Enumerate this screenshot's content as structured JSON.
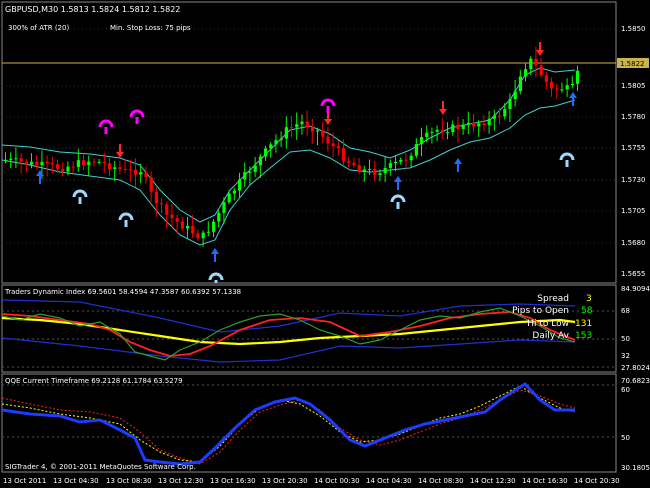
{
  "main": {
    "title": "GBPUSD,M30  1.5813 1.5824 1.5812 1.5822",
    "info_atr": "300% of ATR (20)",
    "info_stop": "Min. Stop Loss:  75 pips",
    "price_label": "1.5822",
    "y_ticks": [
      "1.5850",
      "1.5805",
      "1.5780",
      "1.5755",
      "1.5730",
      "1.5705",
      "1.5680",
      "1.5655"
    ],
    "colors": {
      "bull": "#00ff00",
      "bear": "#ff0000",
      "band": "#40d0d0",
      "price_line": "#c8b44c",
      "arrow_up": "#1e6cff",
      "arrow_down": "#ff2828",
      "fractal_top": "#ff00ff",
      "fractal_bot": "#9fd8ff"
    }
  },
  "tdi": {
    "title": "Traders Dynamic Index 69.5601 58.4594 47.3587 60.6392 57.1338",
    "y_ticks": [
      "84.9094",
      "68",
      "50",
      "32",
      "27.8024"
    ],
    "stats": [
      {
        "label": "Spread",
        "value": "3",
        "color": "#ffff00"
      },
      {
        "label": "Pips to Open",
        "value": "58",
        "color": "#00ff00"
      },
      {
        "label": "Hi to Low",
        "value": "131",
        "color": "#ffff00"
      },
      {
        "label": "Daily Av",
        "value": "153",
        "color": "#00ff00"
      }
    ],
    "colors": {
      "green": "#2e9e2e",
      "red": "#ff2222",
      "yellow": "#ffff00",
      "blue": "#2030d0"
    }
  },
  "qqe": {
    "title": "QQE Current Timeframe 69.2128 61.1784 63.5279",
    "y_ticks": [
      "70.6823",
      "60",
      "50",
      "30.1805"
    ],
    "colors": {
      "blue": "#1e3cff",
      "yellow": "#ffff00",
      "red": "#ff2020"
    }
  },
  "footer": {
    "copyright": "SIGTrader 4, © 2001-2011 MetaQuotes Software Corp."
  },
  "time_axis": [
    "13 Oct 2011",
    "13 Oct 04:30",
    "13 Oct 08:30",
    "13 Oct 12:30",
    "13 Oct 16:30",
    "13 Oct 20:30",
    "14 Oct 00:30",
    "14 Oct 04:30",
    "14 Oct 08:30",
    "14 Oct 12:30",
    "14 Oct 16:30",
    "14 Oct 20:30"
  ]
}
